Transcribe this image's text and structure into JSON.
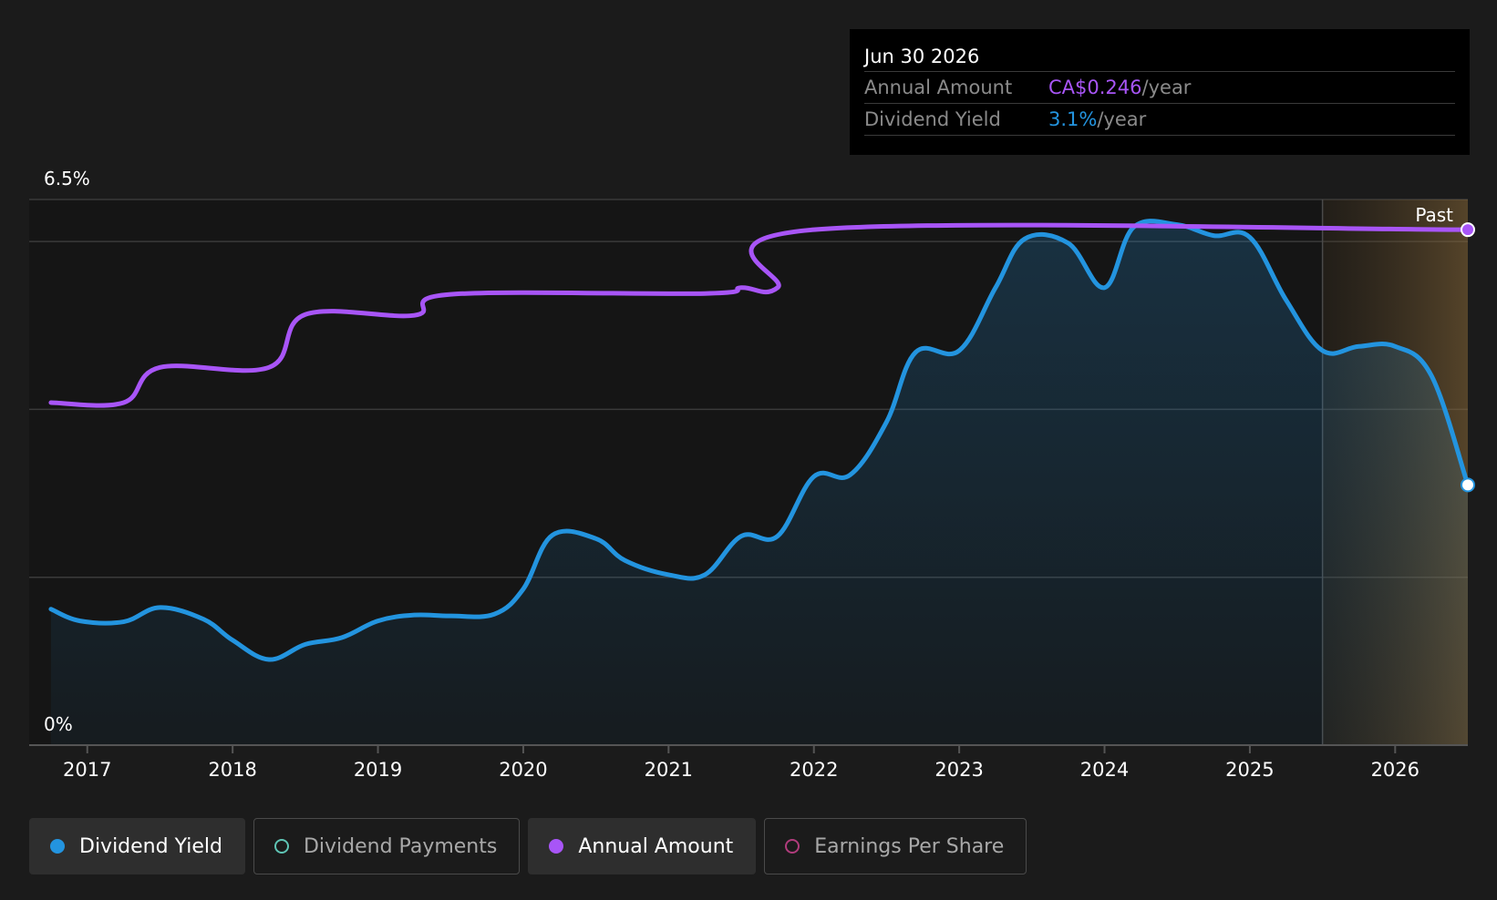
{
  "chart_data": {
    "type": "line",
    "x_axis": {
      "ticks": [
        "2017",
        "2018",
        "2019",
        "2020",
        "2021",
        "2022",
        "2023",
        "2024",
        "2025",
        "2026"
      ],
      "range": [
        2016.6,
        2026.5
      ]
    },
    "y_axis": {
      "top_label": "6.5%",
      "bottom_label": "0%",
      "range": [
        0,
        6.5
      ],
      "gridlines": [
        2,
        4,
        6,
        6.5
      ]
    },
    "past_label": "Past",
    "past_start": 2025.5,
    "series": [
      {
        "name": "Dividend Yield",
        "color": "#2394df",
        "area": true,
        "points": [
          [
            2016.75,
            1.62
          ],
          [
            2016.95,
            1.48
          ],
          [
            2017.25,
            1.47
          ],
          [
            2017.5,
            1.64
          ],
          [
            2017.8,
            1.5
          ],
          [
            2018.0,
            1.25
          ],
          [
            2018.25,
            1.02
          ],
          [
            2018.5,
            1.2
          ],
          [
            2018.75,
            1.28
          ],
          [
            2019.0,
            1.48
          ],
          [
            2019.25,
            1.55
          ],
          [
            2019.5,
            1.54
          ],
          [
            2019.8,
            1.56
          ],
          [
            2020.0,
            1.86
          ],
          [
            2020.2,
            2.5
          ],
          [
            2020.5,
            2.46
          ],
          [
            2020.7,
            2.2
          ],
          [
            2021.0,
            2.03
          ],
          [
            2021.25,
            2.03
          ],
          [
            2021.5,
            2.49
          ],
          [
            2021.75,
            2.49
          ],
          [
            2022.0,
            3.2
          ],
          [
            2022.25,
            3.22
          ],
          [
            2022.5,
            3.85
          ],
          [
            2022.7,
            4.68
          ],
          [
            2023.0,
            4.7
          ],
          [
            2023.25,
            5.45
          ],
          [
            2023.45,
            6.03
          ],
          [
            2023.75,
            5.98
          ],
          [
            2024.0,
            5.45
          ],
          [
            2024.2,
            6.17
          ],
          [
            2024.5,
            6.2
          ],
          [
            2024.75,
            6.07
          ],
          [
            2025.0,
            6.05
          ],
          [
            2025.25,
            5.3
          ],
          [
            2025.5,
            4.7
          ],
          [
            2025.75,
            4.75
          ],
          [
            2026.0,
            4.75
          ],
          [
            2026.25,
            4.4
          ],
          [
            2026.5,
            3.1
          ]
        ]
      },
      {
        "name": "Annual Amount",
        "color": "#a855f7",
        "area": false,
        "points": [
          [
            2016.75,
            4.08
          ],
          [
            2017.25,
            4.08
          ],
          [
            2017.5,
            4.5
          ],
          [
            2018.25,
            4.5
          ],
          [
            2018.5,
            5.13
          ],
          [
            2019.25,
            5.12
          ],
          [
            2019.5,
            5.37
          ],
          [
            2021.25,
            5.38
          ],
          [
            2021.5,
            5.45
          ],
          [
            2021.75,
            5.45
          ],
          [
            2022.0,
            6.14
          ],
          [
            2026.5,
            6.14
          ]
        ]
      }
    ],
    "tooltip": {
      "date": "Jun 30 2026",
      "rows": [
        {
          "label": "Annual Amount",
          "value": "CA$0.246",
          "unit": "/year"
        },
        {
          "label": "Dividend Yield",
          "value": "3.1%",
          "unit": "/year"
        }
      ]
    }
  },
  "legend": [
    {
      "label": "Dividend Yield",
      "color": "#2394df",
      "active": true,
      "filled": true
    },
    {
      "label": "Dividend Payments",
      "color": "#5fc5b5",
      "active": false,
      "filled": false
    },
    {
      "label": "Annual Amount",
      "color": "#a855f7",
      "active": true,
      "filled": true
    },
    {
      "label": "Earnings Per Share",
      "color": "#b03c7c",
      "active": false,
      "filled": false
    }
  ]
}
